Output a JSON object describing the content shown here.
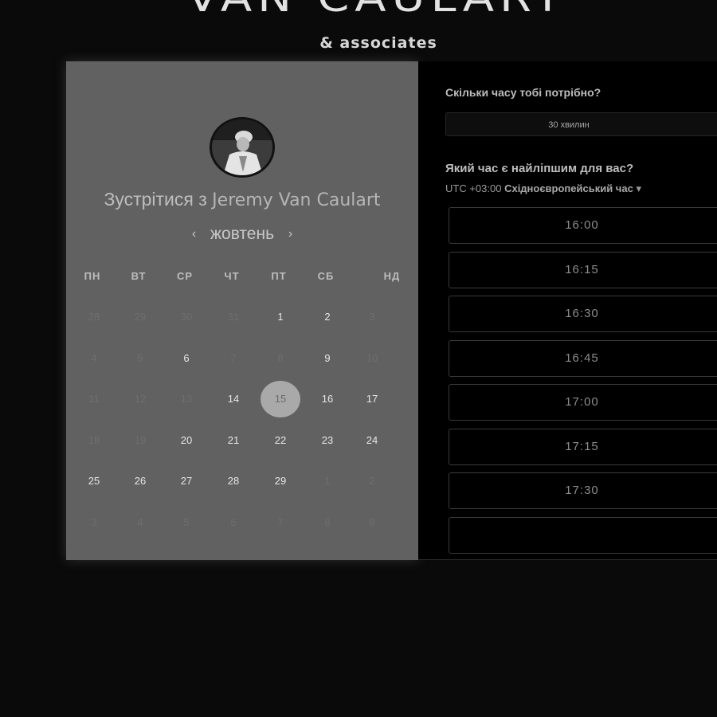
{
  "brand": {
    "title": "VAN CAULART",
    "subtitle": "& associates"
  },
  "host": {
    "meet_prefix": "Зустрітися з",
    "name": "Jeremy Van Caulart"
  },
  "calendar": {
    "month": "жовтень",
    "prev_icon": "‹",
    "next_icon": "›",
    "weekdays": [
      "ПН",
      "ВТ",
      "СР",
      "ЧТ",
      "ПТ",
      "СБ",
      "НД"
    ],
    "weeks": [
      [
        {
          "d": "28",
          "s": "muted"
        },
        {
          "d": "29",
          "s": "muted"
        },
        {
          "d": "30",
          "s": "muted"
        },
        {
          "d": "31",
          "s": "muted"
        },
        {
          "d": "1",
          "s": "active"
        },
        {
          "d": "2",
          "s": "active"
        },
        {
          "d": "3",
          "s": "muted"
        }
      ],
      [
        {
          "d": "4",
          "s": "muted"
        },
        {
          "d": "5",
          "s": "muted"
        },
        {
          "d": "6",
          "s": "active"
        },
        {
          "d": "7",
          "s": "muted"
        },
        {
          "d": "8",
          "s": "muted"
        },
        {
          "d": "9",
          "s": "active"
        },
        {
          "d": "10",
          "s": "muted"
        }
      ],
      [
        {
          "d": "11",
          "s": "muted"
        },
        {
          "d": "12",
          "s": "muted"
        },
        {
          "d": "13",
          "s": "muted"
        },
        {
          "d": "14",
          "s": "active"
        },
        {
          "d": "15",
          "s": "selected"
        },
        {
          "d": "16",
          "s": "active"
        },
        {
          "d": "17",
          "s": "active"
        }
      ],
      [
        {
          "d": "18",
          "s": "muted"
        },
        {
          "d": "19",
          "s": "muted"
        },
        {
          "d": "20",
          "s": "active"
        },
        {
          "d": "21",
          "s": "active"
        },
        {
          "d": "22",
          "s": "active"
        },
        {
          "d": "23",
          "s": "active"
        },
        {
          "d": "24",
          "s": "active"
        }
      ],
      [
        {
          "d": "25",
          "s": "active"
        },
        {
          "d": "26",
          "s": "active"
        },
        {
          "d": "27",
          "s": "active"
        },
        {
          "d": "28",
          "s": "active"
        },
        {
          "d": "29",
          "s": "active"
        },
        {
          "d": "1",
          "s": "muted"
        },
        {
          "d": "2",
          "s": "muted"
        }
      ],
      [
        {
          "d": "3",
          "s": "muted"
        },
        {
          "d": "4",
          "s": "muted"
        },
        {
          "d": "5",
          "s": "muted"
        },
        {
          "d": "6",
          "s": "muted"
        },
        {
          "d": "7",
          "s": "muted"
        },
        {
          "d": "8",
          "s": "muted"
        },
        {
          "d": "9",
          "s": "muted"
        }
      ]
    ]
  },
  "booking": {
    "duration_question": "Скільки часу тобі потрібно?",
    "duration_value": "30 хвилин",
    "time_question": "Який час є найліпшим для вас?",
    "timezone_offset": "UTC +03:00",
    "timezone_name": "Східноєвропейський час",
    "timezone_caret": "▾",
    "slots": [
      "16:00",
      "16:15",
      "16:30",
      "16:45",
      "17:00",
      "17:15",
      "17:30"
    ]
  },
  "colors": {
    "background": "#0a0a0a",
    "calendar_panel": "#616161",
    "selected_day": "#a9a9a9",
    "slot_border": "#3a3a3a"
  }
}
